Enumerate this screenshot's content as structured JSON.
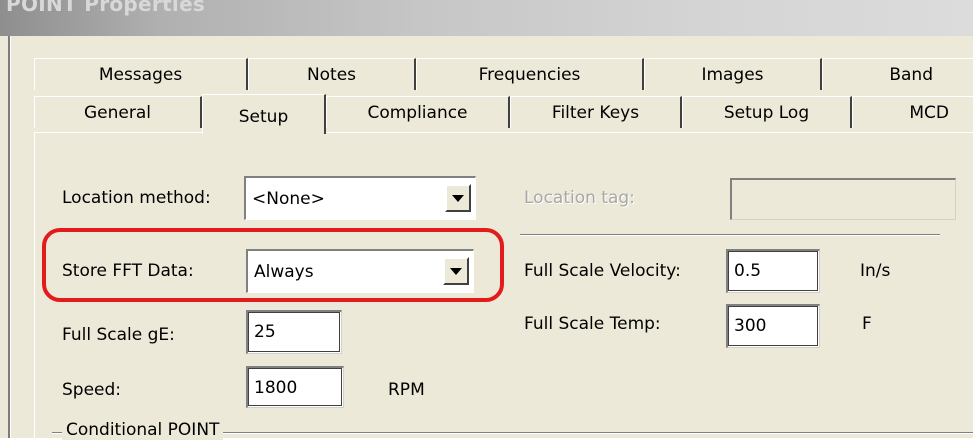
{
  "window": {
    "title": "POINT Properties"
  },
  "tabs_row1": [
    "Messages",
    "Notes",
    "Frequencies",
    "Images",
    "Band"
  ],
  "tabs_row2": [
    "General",
    "Setup",
    "Compliance",
    "Filter Keys",
    "Setup Log",
    "MCD"
  ],
  "active_tab": "Setup",
  "location_method": {
    "label": "Location method:",
    "value": "<None>"
  },
  "location_tag": {
    "label": "Location tag:",
    "value": ""
  },
  "store_fft": {
    "label": "Store FFT Data:",
    "value": "Always"
  },
  "full_scale_velocity": {
    "label": "Full Scale Velocity:",
    "value": "0.5",
    "unit": "In/s"
  },
  "full_scale_ge": {
    "label": "Full Scale gE:",
    "value": "25"
  },
  "full_scale_temp": {
    "label": "Full Scale Temp:",
    "value": "300",
    "unit": "F"
  },
  "speed": {
    "label": "Speed:",
    "value": "1800",
    "unit": "RPM"
  },
  "conditional_group": {
    "label": "Conditional POINT"
  },
  "colors": {
    "highlight": "#e41b1b",
    "dialog_bg": "#ece9d8"
  }
}
